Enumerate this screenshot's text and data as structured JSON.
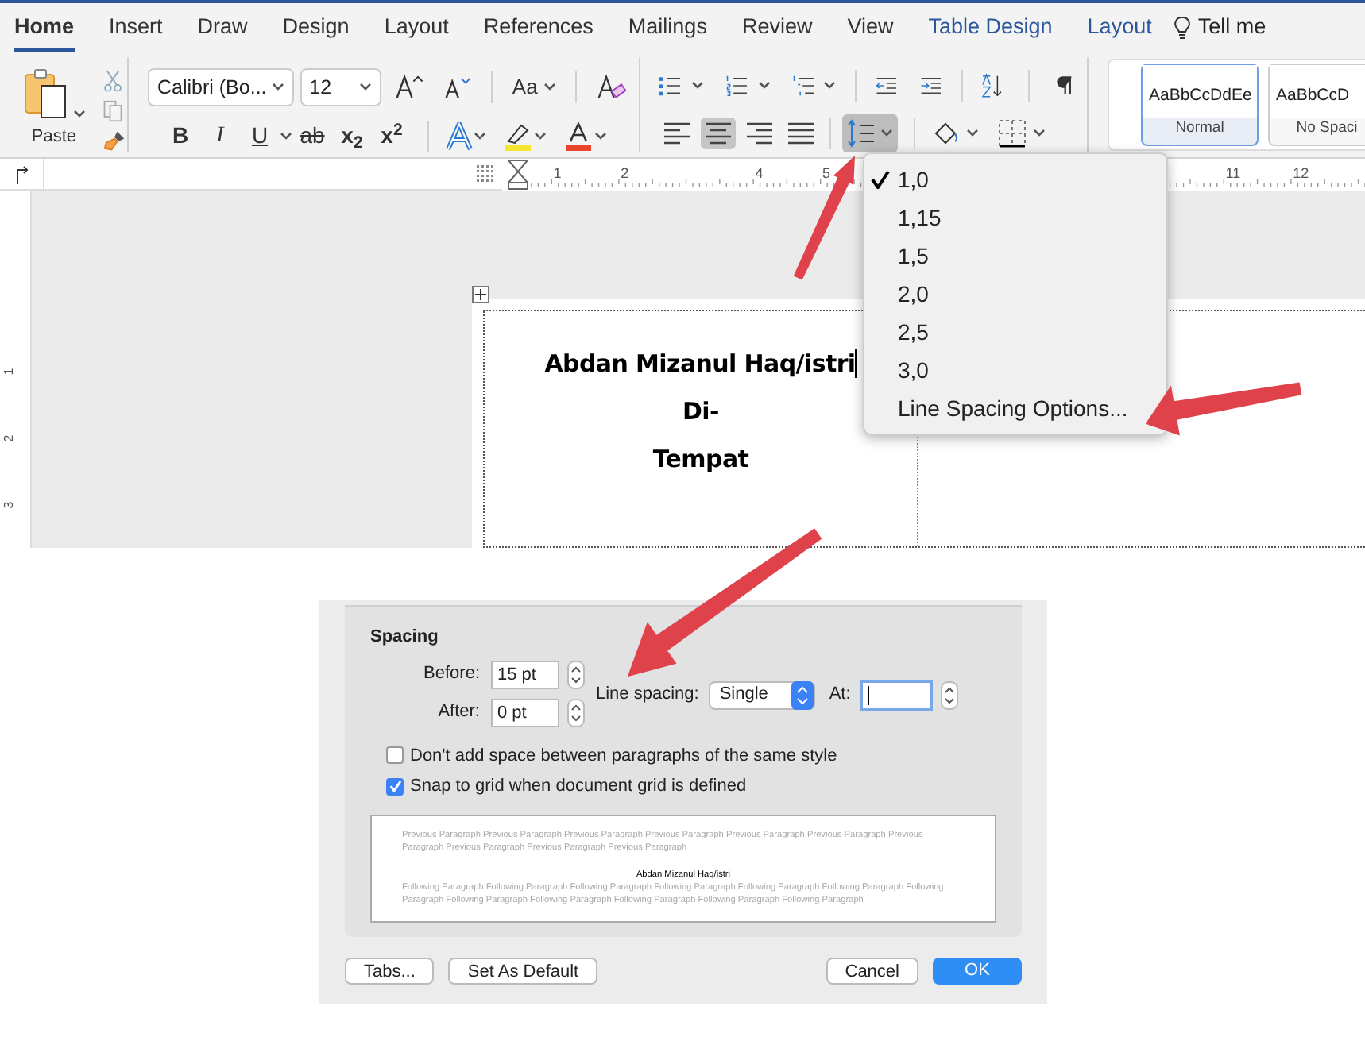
{
  "tabs": [
    {
      "label": "Home",
      "selected": true,
      "kind": "normal"
    },
    {
      "label": "Insert",
      "selected": false,
      "kind": "normal"
    },
    {
      "label": "Draw",
      "selected": false,
      "kind": "normal"
    },
    {
      "label": "Design",
      "selected": false,
      "kind": "normal"
    },
    {
      "label": "Layout",
      "selected": false,
      "kind": "normal"
    },
    {
      "label": "References",
      "selected": false,
      "kind": "normal"
    },
    {
      "label": "Mailings",
      "selected": false,
      "kind": "normal"
    },
    {
      "label": "Review",
      "selected": false,
      "kind": "normal"
    },
    {
      "label": "View",
      "selected": false,
      "kind": "normal"
    },
    {
      "label": "Table Design",
      "selected": false,
      "kind": "contextual"
    },
    {
      "label": "Layout",
      "selected": false,
      "kind": "contextual"
    }
  ],
  "tell_me": "Tell me",
  "clipboard": {
    "paste_label": "Paste"
  },
  "font": {
    "name": "Calibri (Bo...",
    "size": "12",
    "case_label": "Aa"
  },
  "format_buttons": [
    {
      "text": "B",
      "kind": "bold"
    },
    {
      "text": "I",
      "kind": "italic"
    },
    {
      "text": "U",
      "kind": "underline"
    },
    {
      "text": "ab",
      "kind": "strike"
    },
    {
      "text": "x$_{2}$",
      "kind": "sub"
    },
    {
      "text": "x$^{2}$",
      "kind": "sup"
    }
  ],
  "align_buttons": [
    {
      "selected": false,
      "kind": "left"
    },
    {
      "selected": true,
      "kind": "center"
    },
    {
      "selected": false,
      "kind": "right"
    },
    {
      "selected": false,
      "kind": "justify"
    }
  ],
  "styles": [
    {
      "preview": "AaBbCcDdEe",
      "name": "Normal",
      "selected": true
    },
    {
      "preview": "AaBbCcD",
      "name": "No Spaci",
      "selected": false
    }
  ],
  "ruler_labels": [
    "1",
    "2",
    "4",
    "5",
    "11",
    "12"
  ],
  "vertical_ruler_labels": [
    "1",
    "2",
    "3"
  ],
  "document": {
    "lines": [
      "Abdan Mizanul Haq/istri",
      "Di-",
      "Tempat"
    ]
  },
  "line_spacing_menu": [
    {
      "label": "1,0",
      "checked": true
    },
    {
      "label": "1,15",
      "checked": false
    },
    {
      "label": "1,5",
      "checked": false
    },
    {
      "label": "2,0",
      "checked": false
    },
    {
      "label": "2,5",
      "checked": false
    },
    {
      "label": "3,0",
      "checked": false
    },
    {
      "label": "Line Spacing Options...",
      "checked": false
    }
  ],
  "dialog": {
    "section": "Spacing",
    "before": {
      "label": "Before:",
      "value": "15 pt"
    },
    "after": {
      "label": "After:",
      "value": "0 pt"
    },
    "line_spacing": {
      "label": "Line spacing:",
      "value": "Single"
    },
    "at": {
      "label": "At:",
      "focused": true
    },
    "checkboxes": [
      {
        "label": "Don't add space between paragraphs of the same style",
        "checked": false
      },
      {
        "label": "Snap to grid when document grid is defined",
        "checked": true
      }
    ],
    "preview": {
      "previous": "Previous Paragraph Previous Paragraph Previous Paragraph Previous Paragraph Previous Paragraph Previous Paragraph Previous Paragraph Previous Paragraph Previous Paragraph Previous Paragraph",
      "sample": "Abdan Mizanul Haq/istri",
      "following": "Following Paragraph Following Paragraph Following Paragraph Following Paragraph Following Paragraph Following Paragraph Following Paragraph Following Paragraph Following Paragraph Following Paragraph Following Paragraph Following Paragraph"
    },
    "buttons": [
      {
        "label": "Tabs...",
        "kind": "normal"
      },
      {
        "label": "Set As Default",
        "kind": "normal"
      },
      {
        "label": "Cancel",
        "kind": "normal"
      },
      {
        "label": "OK",
        "kind": "default"
      }
    ]
  }
}
